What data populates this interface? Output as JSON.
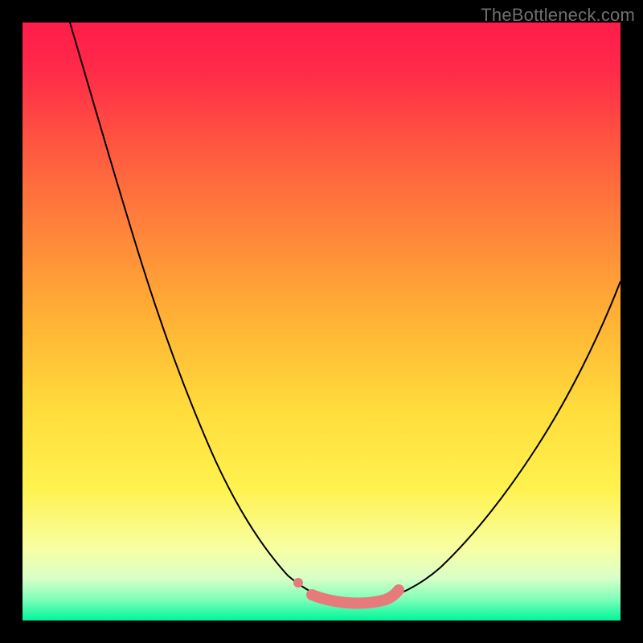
{
  "watermark": "TheBottleneck.com",
  "chart_data": {
    "type": "line",
    "title": "",
    "xlabel": "",
    "ylabel": "",
    "xlim": [
      0,
      100
    ],
    "ylim": [
      0,
      100
    ],
    "grid": false,
    "gradient_stops": [
      {
        "t": 0.0,
        "hex": "#ff1d4a"
      },
      {
        "t": 0.08,
        "hex": "#ff2a49"
      },
      {
        "t": 0.2,
        "hex": "#ff5540"
      },
      {
        "t": 0.35,
        "hex": "#ff853a"
      },
      {
        "t": 0.5,
        "hex": "#ffb335"
      },
      {
        "t": 0.65,
        "hex": "#ffdd3c"
      },
      {
        "t": 0.78,
        "hex": "#fff24f"
      },
      {
        "t": 0.88,
        "hex": "#f8ffa3"
      },
      {
        "t": 0.93,
        "hex": "#d8ffc7"
      },
      {
        "t": 0.965,
        "hex": "#7dffb9"
      },
      {
        "t": 1.0,
        "hex": "#00f59a"
      }
    ],
    "annotations": [
      {
        "kind": "highlight-segment",
        "color": "#e77b7b",
        "x_range": [
          48.5,
          62.5
        ],
        "y": 95
      },
      {
        "kind": "highlight-dot",
        "color": "#e77b7b",
        "x": 46,
        "y": 93
      }
    ],
    "series": [
      {
        "name": "left-branch",
        "x": [
          8,
          12,
          16,
          20,
          24,
          28,
          32,
          36,
          40,
          44,
          48,
          51,
          53
        ],
        "y": [
          0,
          14,
          28,
          41,
          53,
          64,
          73,
          81,
          87,
          92,
          95,
          96.5,
          97
        ]
      },
      {
        "name": "right-branch",
        "x": [
          60,
          64,
          68,
          72,
          76,
          80,
          84,
          88,
          92,
          96,
          99.5
        ],
        "y": [
          96.5,
          94.5,
          91,
          86,
          80,
          73,
          65,
          56,
          47,
          38,
          31
        ]
      }
    ],
    "note": "y measured from top; larger y = lower on chart. V-shaped curve, minimum (in chart's value sense) near x≈55."
  }
}
